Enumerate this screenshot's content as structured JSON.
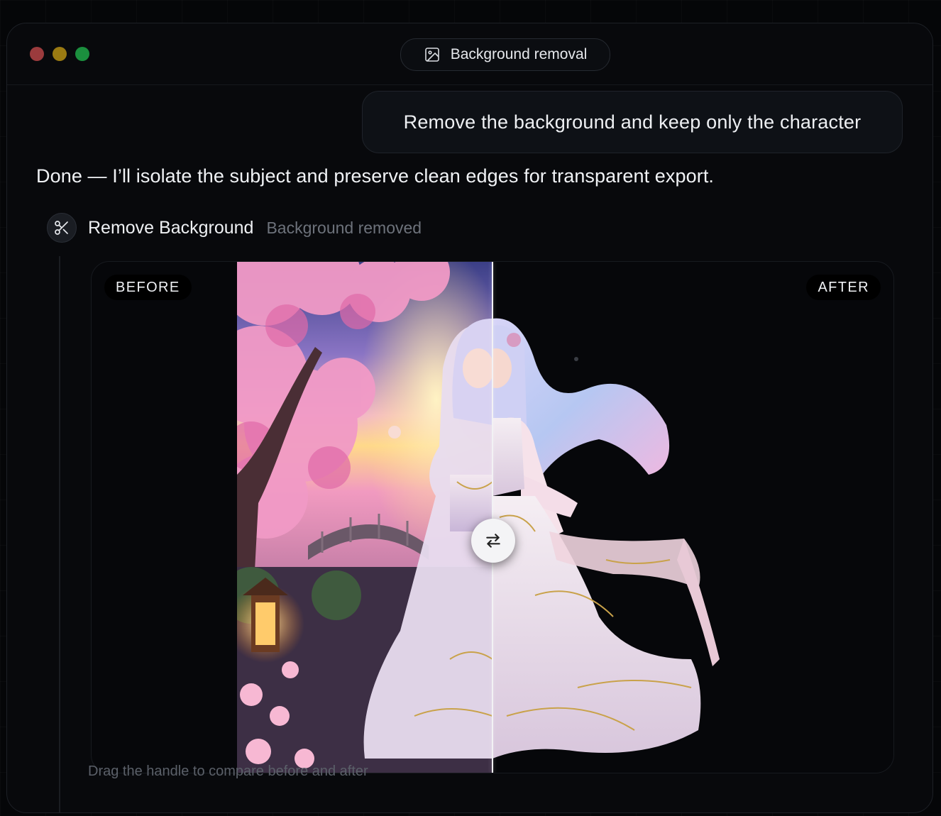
{
  "window": {
    "title": "Background removal",
    "title_icon": "image-icon",
    "controls": [
      "close",
      "minimize",
      "maximize"
    ]
  },
  "chat": {
    "user_message": "Remove the background and keep only the character",
    "assistant_message": "Done — I’ll isolate the subject and preserve clean edges for transparent export."
  },
  "tool": {
    "icon": "scissors-icon",
    "name": "Remove Background",
    "status": "Background removed"
  },
  "compare": {
    "before_label": "BEFORE",
    "after_label": "AFTER",
    "handle_icon": "swap-arrows-icon",
    "split_position": 0.5,
    "hint": "Drag the handle to compare before and after"
  },
  "colors": {
    "background": "#050608",
    "window": "#08090c",
    "dot_red": "#9b3b3d",
    "dot_yellow": "#9a7a12",
    "dot_green": "#1b8f3e",
    "muted_text": "#6d727b"
  }
}
